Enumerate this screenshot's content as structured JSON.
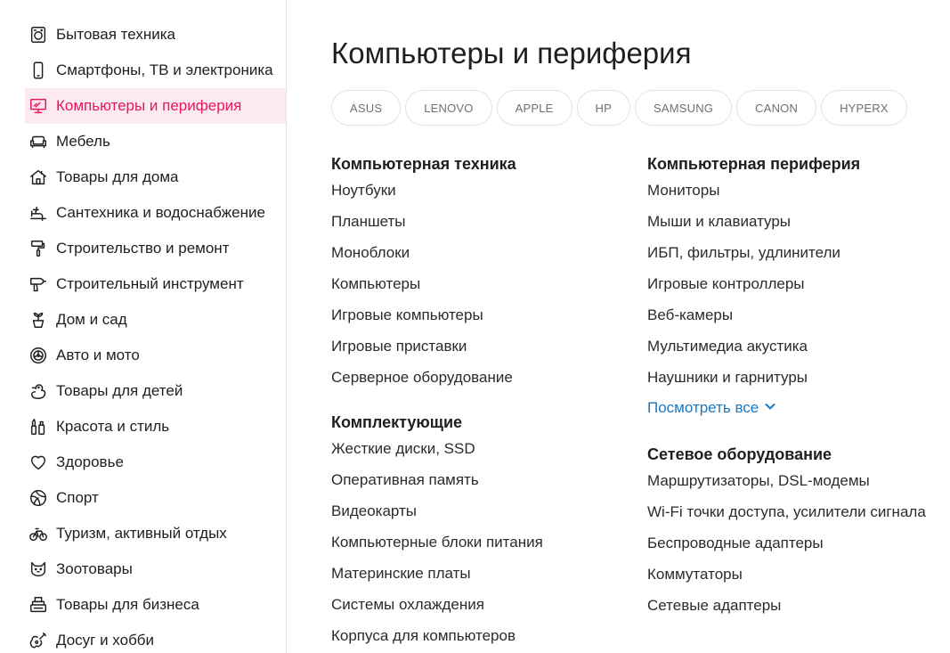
{
  "sidebar": {
    "items": [
      {
        "label": "Бытовая техника",
        "icon": "washing-machine-icon",
        "active": false
      },
      {
        "label": "Смартфоны, ТВ и электроника",
        "icon": "smartphone-icon",
        "active": false
      },
      {
        "label": "Компьютеры и периферия",
        "icon": "computer-icon",
        "active": true
      },
      {
        "label": "Мебель",
        "icon": "sofa-icon",
        "active": false
      },
      {
        "label": "Товары для дома",
        "icon": "house-icon",
        "active": false
      },
      {
        "label": "Сантехника и водоснабжение",
        "icon": "faucet-icon",
        "active": false
      },
      {
        "label": "Строительство и ремонт",
        "icon": "paint-roller-icon",
        "active": false
      },
      {
        "label": "Строительный инструмент",
        "icon": "drill-icon",
        "active": false
      },
      {
        "label": "Дом и сад",
        "icon": "plant-pot-icon",
        "active": false
      },
      {
        "label": "Авто и мото",
        "icon": "wheel-icon",
        "active": false
      },
      {
        "label": "Товары для детей",
        "icon": "duck-icon",
        "active": false
      },
      {
        "label": "Красота и стиль",
        "icon": "cosmetics-icon",
        "active": false
      },
      {
        "label": "Здоровье",
        "icon": "heart-icon",
        "active": false
      },
      {
        "label": "Спорт",
        "icon": "ball-icon",
        "active": false
      },
      {
        "label": "Туризм, активный отдых",
        "icon": "bicycle-icon",
        "active": false
      },
      {
        "label": "Зоотовары",
        "icon": "cat-icon",
        "active": false
      },
      {
        "label": "Товары для бизнеса",
        "icon": "cash-register-icon",
        "active": false
      },
      {
        "label": "Досуг и хобби",
        "icon": "guitar-icon",
        "active": false
      }
    ]
  },
  "main": {
    "title": "Компьютеры и периферия",
    "brands": [
      "ASUS",
      "LENOVO",
      "APPLE",
      "HP",
      "SAMSUNG",
      "CANON",
      "HYPERX"
    ],
    "left_column": [
      {
        "title": "Компьютерная техника",
        "links": [
          "Ноутбуки",
          "Планшеты",
          "Моноблоки",
          "Компьютеры",
          "Игровые компьютеры",
          "Игровые приставки",
          "Серверное оборудование"
        ]
      },
      {
        "title": "Комплектующие",
        "links": [
          "Жесткие диски, SSD",
          "Оперативная память",
          "Видеокарты",
          "Компьютерные блоки питания",
          "Материнские платы",
          "Системы охлаждения",
          "Корпуса для компьютеров"
        ]
      }
    ],
    "right_column": [
      {
        "title": "Компьютерная периферия",
        "links": [
          "Мониторы",
          "Мыши и клавиатуры",
          "ИБП, фильтры, удлинители",
          "Игровые контроллеры",
          "Веб-камеры",
          "Мультимедиа акустика",
          "Наушники и гарнитуры"
        ],
        "more": "Посмотреть все"
      },
      {
        "title": "Сетевое оборудование",
        "links": [
          "Маршрутизаторы, DSL-модемы",
          "Wi-Fi точки доступа, усилители сигнала",
          "Беспроводные адаптеры",
          "Коммутаторы",
          "Сетевые адаптеры"
        ]
      }
    ]
  },
  "colors": {
    "accent": "#e8175d",
    "active_bg": "#fdeaf0",
    "link_more": "#1a78c2"
  }
}
